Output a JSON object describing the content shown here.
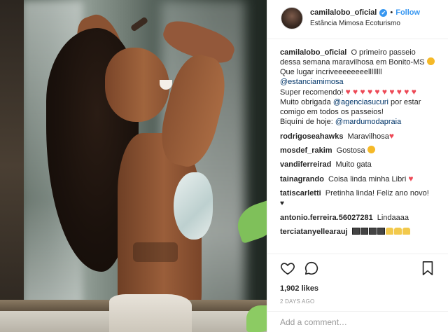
{
  "header": {
    "username": "camilalobo_oficial",
    "verified_glyph": "✔",
    "dot": "•",
    "follow_label": "Follow",
    "location": "Estância Mimosa Ecoturismo"
  },
  "caption": {
    "username": "camilalobo_oficial",
    "line1": "O primeiro passeio dessa semana maravilhosa em Bonito-MS",
    "line2": "Que lugar incriveeeeeeeellllllll",
    "mention1": "@estanciamimosa",
    "line3": "Super recomendo!",
    "hearts": "♥ ♥ ♥ ♥ ♥ ♥ ♥ ♥ ♥ ♥",
    "line4a": "Muito obrigada",
    "mention2": "@agenciasucuri",
    "line4b": "por estar comigo em todos os passeios!",
    "line5a": "Biquíni de hoje:",
    "mention3": "@mardumodapraia"
  },
  "comments": [
    {
      "user": "rodrigoseahawks",
      "text": "Maravilhosa",
      "suffix": "♥"
    },
    {
      "user": "mosdef_rakim",
      "text": "Gostosa",
      "suffix": ""
    },
    {
      "user": "vandiferreirad",
      "text": "Muito gata",
      "suffix": ""
    },
    {
      "user": "tainagrando",
      "text": "Coisa linda minha Libri",
      "suffix": "♥"
    },
    {
      "user": "tatiscarletti",
      "text": "Pretinha linda! Feliz ano novo!",
      "suffix": "♥"
    },
    {
      "user": "antonio.ferreira.56027281",
      "text": "Lindaaaa",
      "suffix": ""
    },
    {
      "user": "terciatanyellearauj",
      "text": "",
      "suffix": ""
    }
  ],
  "stats": {
    "likes": "1,902 likes",
    "date": "2 DAYS AGO"
  },
  "add_comment": {
    "placeholder": "Add a comment…"
  },
  "icons": {
    "like": "heart-outline-icon",
    "comment": "speech-bubble-icon",
    "save": "bookmark-icon",
    "verified": "verified-badge-icon"
  },
  "colors": {
    "link": "#3897f0",
    "mention": "#003569",
    "heart": "#ed4956",
    "muted": "#999999"
  }
}
